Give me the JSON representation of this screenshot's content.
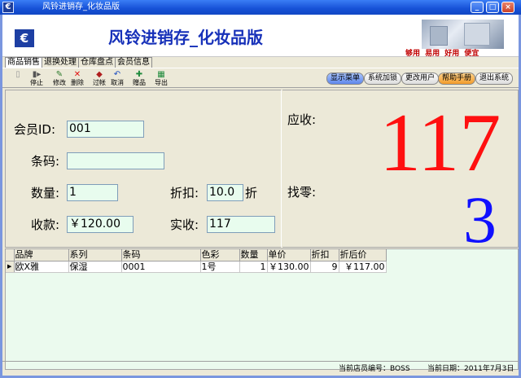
{
  "window": {
    "title": "风铃进销存_化妆品版"
  },
  "banner": {
    "brand": "风铃进销存_化妆品版",
    "slogan": "够用  易用  好用  便宜"
  },
  "tabs": [
    "商品销售",
    "退换处理",
    "仓库盘点",
    "会员信息"
  ],
  "toolbar": {
    "buttons": [
      {
        "label": "",
        "icon": "new-icon",
        "enabled": false
      },
      {
        "label": "停止",
        "icon": "stop-icon",
        "enabled": true
      },
      {
        "label": "修改",
        "icon": "edit-icon",
        "enabled": true
      },
      {
        "label": "删除",
        "icon": "delete-icon",
        "enabled": true
      },
      {
        "label": "过帐",
        "icon": "post-icon",
        "enabled": true
      },
      {
        "label": "取消",
        "icon": "undo-icon",
        "enabled": true
      },
      {
        "label": "赠品",
        "icon": "gift-icon",
        "enabled": true
      },
      {
        "label": "导出",
        "icon": "export-icon",
        "enabled": true
      }
    ],
    "right_buttons": [
      "显示菜单",
      "系统加锁",
      "更改用户",
      "帮助手册",
      "退出系统"
    ]
  },
  "form": {
    "member_id_label": "会员ID:",
    "member_id_value": "001",
    "barcode_label": "条码:",
    "barcode_value": "",
    "quantity_label": "数量:",
    "quantity_value": "1",
    "discount_label": "折扣:",
    "discount_value": "10.0",
    "discount_unit": "折",
    "payment_label": "收款:",
    "payment_value": "￥120.00",
    "actual_label": "实收:",
    "actual_value": "117"
  },
  "summary": {
    "receivable_label": "应收:",
    "receivable_value": "117",
    "change_label": "找零:",
    "change_value": "3"
  },
  "grid": {
    "columns": [
      "品牌",
      "系列",
      "条码",
      "色彩",
      "数量",
      "单价",
      "折扣",
      "折后价"
    ],
    "rows": [
      [
        "欧X雅",
        "保湿",
        "0001",
        "1号",
        "1",
        "￥130.00",
        "9",
        "￥117.00"
      ]
    ]
  },
  "status": {
    "clerk": "当前店员编号：BOSS",
    "date": "当前日期：2011年7月3日"
  },
  "colors": {
    "accent_blue": "#1731b9",
    "big_red": "#ff1010",
    "big_blue": "#1010ff",
    "input_bg": "#e8fcee",
    "grid_bg": "#ebfaee"
  }
}
